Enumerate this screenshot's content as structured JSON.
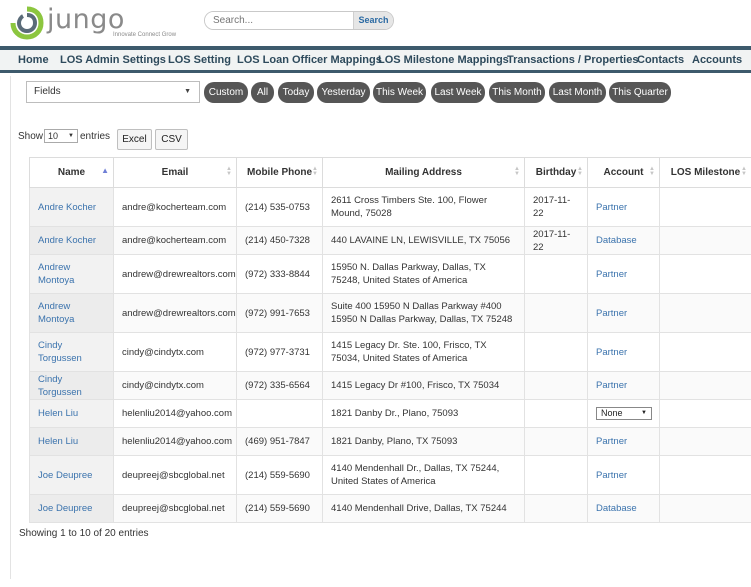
{
  "header": {
    "logo_text": "jungo",
    "logo_tagline": "Innovate Connect Grow",
    "search_placeholder": "Search...",
    "search_button": "Search"
  },
  "nav": {
    "items": [
      {
        "label": "Home"
      },
      {
        "label": "LOS Admin Settings"
      },
      {
        "label": "LOS Setting"
      },
      {
        "label": "LOS Loan Officer Mappings"
      },
      {
        "label": "LOS Milestone Mappings"
      },
      {
        "label": "Transactions / Properties"
      },
      {
        "label": "Contacts"
      },
      {
        "label": "Accounts"
      }
    ]
  },
  "filters": {
    "fields_select": "Fields",
    "date_pills": [
      {
        "label": "Custom"
      },
      {
        "label": "All"
      },
      {
        "label": "Today"
      },
      {
        "label": "Yesterday"
      },
      {
        "label": "This Week"
      },
      {
        "label": "Last Week"
      },
      {
        "label": "This Month"
      },
      {
        "label": "Last Month"
      },
      {
        "label": "This Quarter"
      }
    ]
  },
  "table_controls": {
    "show_label": "Show",
    "page_size": "10",
    "entries_label": "entries",
    "export_buttons": [
      {
        "label": "Excel"
      },
      {
        "label": "CSV"
      }
    ]
  },
  "table": {
    "columns": [
      "Name",
      "Email",
      "Mobile Phone",
      "Mailing Address",
      "Birthday",
      "Account",
      "LOS Milestone"
    ],
    "rows": [
      {
        "name": "Andre Kocher",
        "email": "andre@kocherteam.com",
        "phone": "(214) 535-0753",
        "address": "2611 Cross Timbers Ste. 100, Flower Mound, 75028",
        "birthday": "2017-11-22",
        "account": "Partner",
        "milestone": ""
      },
      {
        "name": "Andre Kocher",
        "email": "andre@kocherteam.com",
        "phone": "(214) 450-7328",
        "address": "440 LAVAINE LN, LEWISVILLE, TX 75056",
        "birthday": "2017-11-22",
        "account": "Database",
        "milestone": ""
      },
      {
        "name": "Andrew Montoya",
        "email": "andrew@drewrealtors.com",
        "phone": "(972) 333-8844",
        "address": "15950 N. Dallas Parkway, Dallas, TX 75248, United States of America",
        "birthday": "",
        "account": "Partner",
        "milestone": ""
      },
      {
        "name": "Andrew Montoya",
        "email": "andrew@drewrealtors.com",
        "phone": "(972) 991-7653",
        "address": "Suite 400 15950 N Dallas Parkway #400 15950 N Dallas Parkway, Dallas, TX 75248",
        "birthday": "",
        "account": "Partner",
        "milestone": ""
      },
      {
        "name": "Cindy Torgussen",
        "email": "cindy@cindytx.com",
        "phone": "(972) 977-3731",
        "address": "1415 Legacy Dr. Ste. 100, Frisco, TX 75034, United States of America",
        "birthday": "",
        "account": "Partner",
        "milestone": ""
      },
      {
        "name": "Cindy Torgussen",
        "email": "cindy@cindytx.com",
        "phone": "(972) 335-6564",
        "address": "1415 Legacy Dr #100, Frisco, TX 75034",
        "birthday": "",
        "account": "Partner",
        "milestone": ""
      },
      {
        "name": "Helen Liu",
        "email": "helenliu2014@yahoo.com",
        "phone": "",
        "address": "1821 Danby Dr., Plano, 75093",
        "birthday": "",
        "account": "None",
        "account_select": true,
        "milestone": ""
      },
      {
        "name": "Helen Liu",
        "email": "helenliu2014@yahoo.com",
        "phone": "(469) 951-7847",
        "address": "1821 Danby, Plano, TX 75093",
        "birthday": "",
        "account": "Partner",
        "milestone": ""
      },
      {
        "name": "Joe Deupree",
        "email": "deupreej@sbcglobal.net",
        "phone": "(214) 559-5690",
        "address": "4140 Mendenhall Dr., Dallas, TX 75244, United States of America",
        "birthday": "",
        "account": "Partner",
        "milestone": ""
      },
      {
        "name": "Joe Deupree",
        "email": "deupreej@sbcglobal.net",
        "phone": "(214) 559-5690",
        "address": "4140 Mendenhall Drive, Dallas, TX 75244",
        "birthday": "",
        "account": "Database",
        "milestone": ""
      }
    ]
  },
  "footer": {
    "info": "Showing 1 to 10 of 20 entries"
  },
  "colors": {
    "nav_accent": "#3d5a6c",
    "link": "#3b73ad",
    "pill_bg": "#565656",
    "logo_green": "#8cc63f",
    "logo_grey": "#8a8a8a"
  }
}
